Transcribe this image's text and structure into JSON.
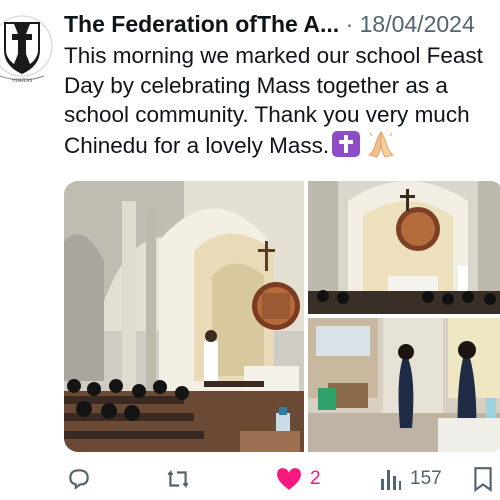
{
  "tweet": {
    "author": "The Federation ofThe A...",
    "separator": "·",
    "date": "18/04/2024",
    "text_lines": [
      "This morning we marked our school Feast",
      "Day by celebrating Mass together as a",
      "school community. Thank you very much",
      "Chinedu for a lovely Mass."
    ],
    "emoji": [
      "latin-cross-emoji",
      "folded-hands-emoji"
    ]
  },
  "avatar": {
    "logo_text": "VERITAS"
  },
  "media": {
    "photos": [
      "church-interior-photo",
      "altar-photo",
      "procession-photo"
    ]
  },
  "actions": {
    "reply_icon": "reply-icon",
    "retweet_icon": "retweet-icon",
    "like_icon": "heart-icon",
    "like_count": "2",
    "views_icon": "views-icon",
    "view_count": "157",
    "bookmark_icon": "bookmark-icon"
  },
  "colors": {
    "text": "#0f1419",
    "muted": "#536471",
    "like": "#f91880"
  }
}
